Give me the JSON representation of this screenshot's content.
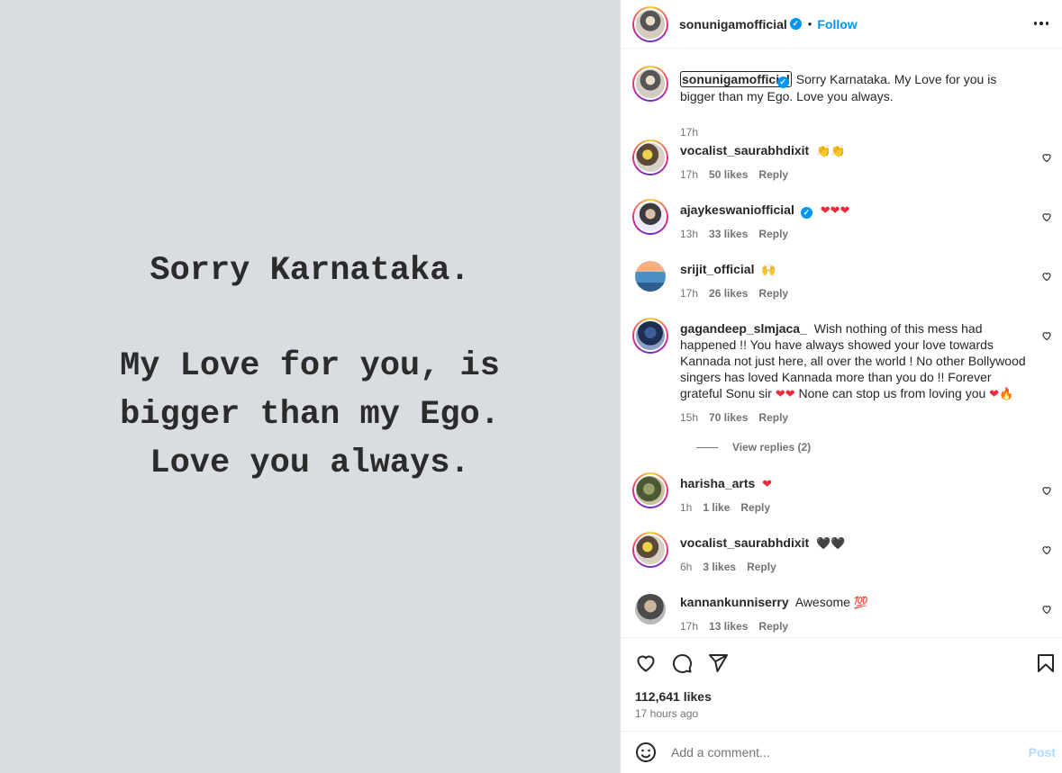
{
  "media": {
    "line1": "Sorry Karnataka.",
    "line2": "My Love for you, is",
    "line3": "bigger than my Ego.",
    "line4": "Love you always."
  },
  "header": {
    "username": "sonunigamofficial",
    "separator": "•",
    "follow_label": "Follow"
  },
  "caption": {
    "username": "sonunigamofficial",
    "text": "Sorry Karnataka. My Love for you is bigger than my Ego. Love you always.",
    "time": "17h"
  },
  "comments": [
    {
      "username": "vocalist_saurabhdixit",
      "verified": false,
      "text": "",
      "emoji": "👏👏",
      "time": "17h",
      "likes": "50 likes",
      "reply": "Reply"
    },
    {
      "username": "ajaykeswaniofficial",
      "verified": true,
      "text": "",
      "emoji": "❤❤❤",
      "time": "13h",
      "likes": "33 likes",
      "reply": "Reply"
    },
    {
      "username": "srijit_official",
      "verified": false,
      "text": "",
      "emoji": "🙌",
      "time": "17h",
      "likes": "26 likes",
      "reply": "Reply"
    },
    {
      "username": "gagandeep_slmjaca_",
      "verified": false,
      "text": "Wish nothing of this mess had happened !! You have always showed your love towards Kannada not just here, all over the world ! No other Bollywood singers has loved Kannada more than you do !! Forever grateful Sonu sir",
      "emoji": "❤❤",
      "text2": "None can stop us from loving you",
      "emoji2": "❤🔥",
      "time": "15h",
      "likes": "70 likes",
      "reply": "Reply",
      "view_replies": "View replies (2)"
    },
    {
      "username": "harisha_arts",
      "verified": false,
      "text": "",
      "emoji": "❤",
      "time": "1h",
      "likes": "1 like",
      "reply": "Reply"
    },
    {
      "username": "vocalist_saurabhdixit",
      "verified": false,
      "text": "",
      "emoji": "🖤🖤",
      "time": "6h",
      "likes": "3 likes",
      "reply": "Reply"
    },
    {
      "username": "kannankunniserry",
      "verified": false,
      "text": "Awesome",
      "emoji": "💯",
      "time": "17h",
      "likes": "13 likes",
      "reply": "Reply"
    }
  ],
  "footer": {
    "likes": "112,641 likes",
    "time": "17 hours ago",
    "comment_placeholder": "Add a comment...",
    "post_label": "Post"
  },
  "colors": {
    "accent": "#0095f6",
    "heart_red": "#ed2a3c",
    "media_bg": "#d9dde1"
  }
}
